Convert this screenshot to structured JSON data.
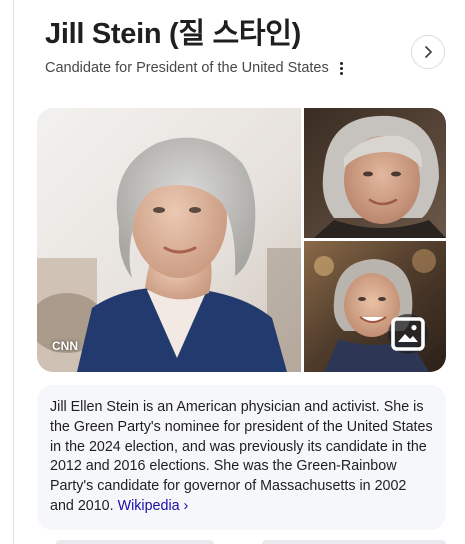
{
  "entity": {
    "title": "Jill Stein (질 스타인)",
    "subtitle": "Candidate for President of the United States",
    "more_icon": "more-vert-icon",
    "next_icon": "chevron-right-icon"
  },
  "images": {
    "source_label": "CNN",
    "images_icon": "image-icon"
  },
  "description": {
    "text": "Jill Ellen Stein is an American physician and activist. She is the Green Party's nominee for president of the United States in the 2024 election, and was previously its candidate in the 2012 and 2016 elections. She was the Green-Rainbow Party's candidate for governor of Massachusetts in 2002 and 2010.",
    "link_label": "Wikipedia ›"
  },
  "colors": {
    "link": "#1a0dab",
    "card_background": "#f5f7fa",
    "subtitle": "#474747"
  }
}
